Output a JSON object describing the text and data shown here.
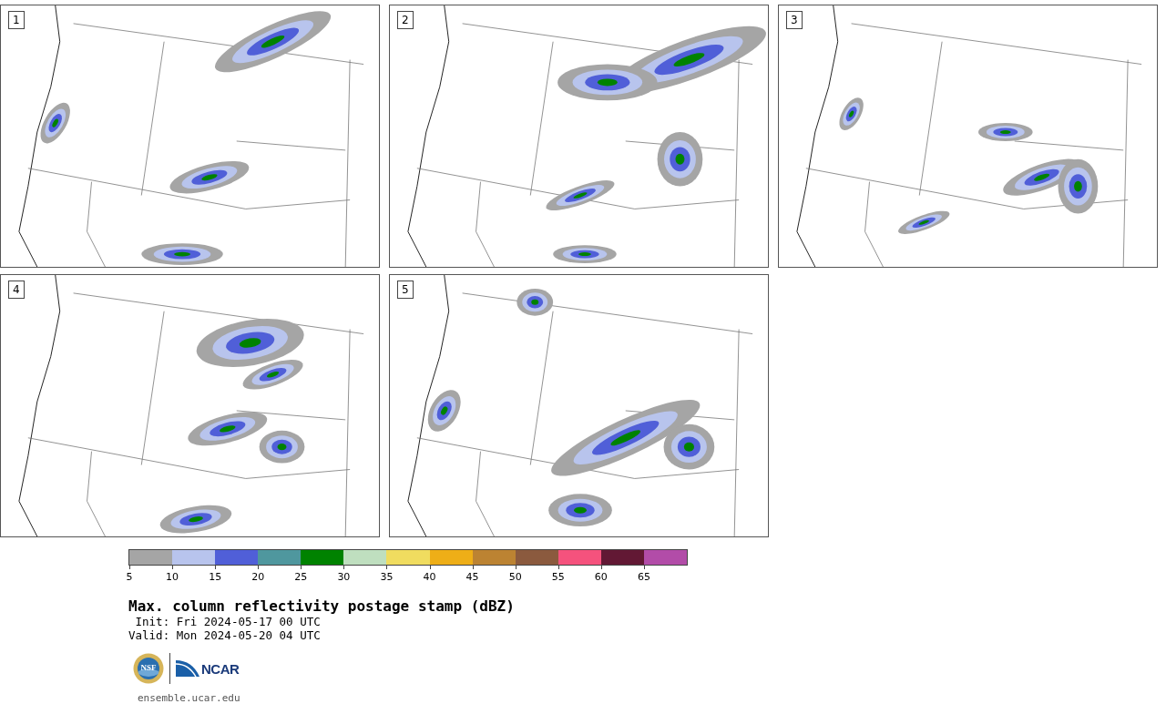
{
  "panels": [
    {
      "label": "1"
    },
    {
      "label": "2"
    },
    {
      "label": "3"
    },
    {
      "label": "4"
    },
    {
      "label": "5"
    }
  ],
  "colorbar": {
    "bins": [
      {
        "color": "#a5a5a5"
      },
      {
        "color": "#b8c4ed"
      },
      {
        "color": "#505fd8"
      },
      {
        "color": "#4f979e"
      },
      {
        "color": "#008200"
      },
      {
        "color": "#bfdfbf"
      },
      {
        "color": "#f0dc5f"
      },
      {
        "color": "#eeae17"
      },
      {
        "color": "#bc8332"
      },
      {
        "color": "#8b5a3e"
      },
      {
        "color": "#f5527d"
      },
      {
        "color": "#621834"
      },
      {
        "color": "#b24ca8"
      }
    ],
    "ticks": [
      "5",
      "10",
      "15",
      "20",
      "25",
      "30",
      "35",
      "40",
      "45",
      "50",
      "55",
      "60",
      "65"
    ]
  },
  "title": "Max. column reflectivity postage stamp (dBZ)",
  "init": " Init: Fri 2024-05-17 00 UTC",
  "valid": "Valid: Mon 2024-05-20 04 UTC",
  "logos": {
    "nsf": "NSF",
    "ncar": "NCAR"
  },
  "url": "ensemble.ucar.edu"
}
